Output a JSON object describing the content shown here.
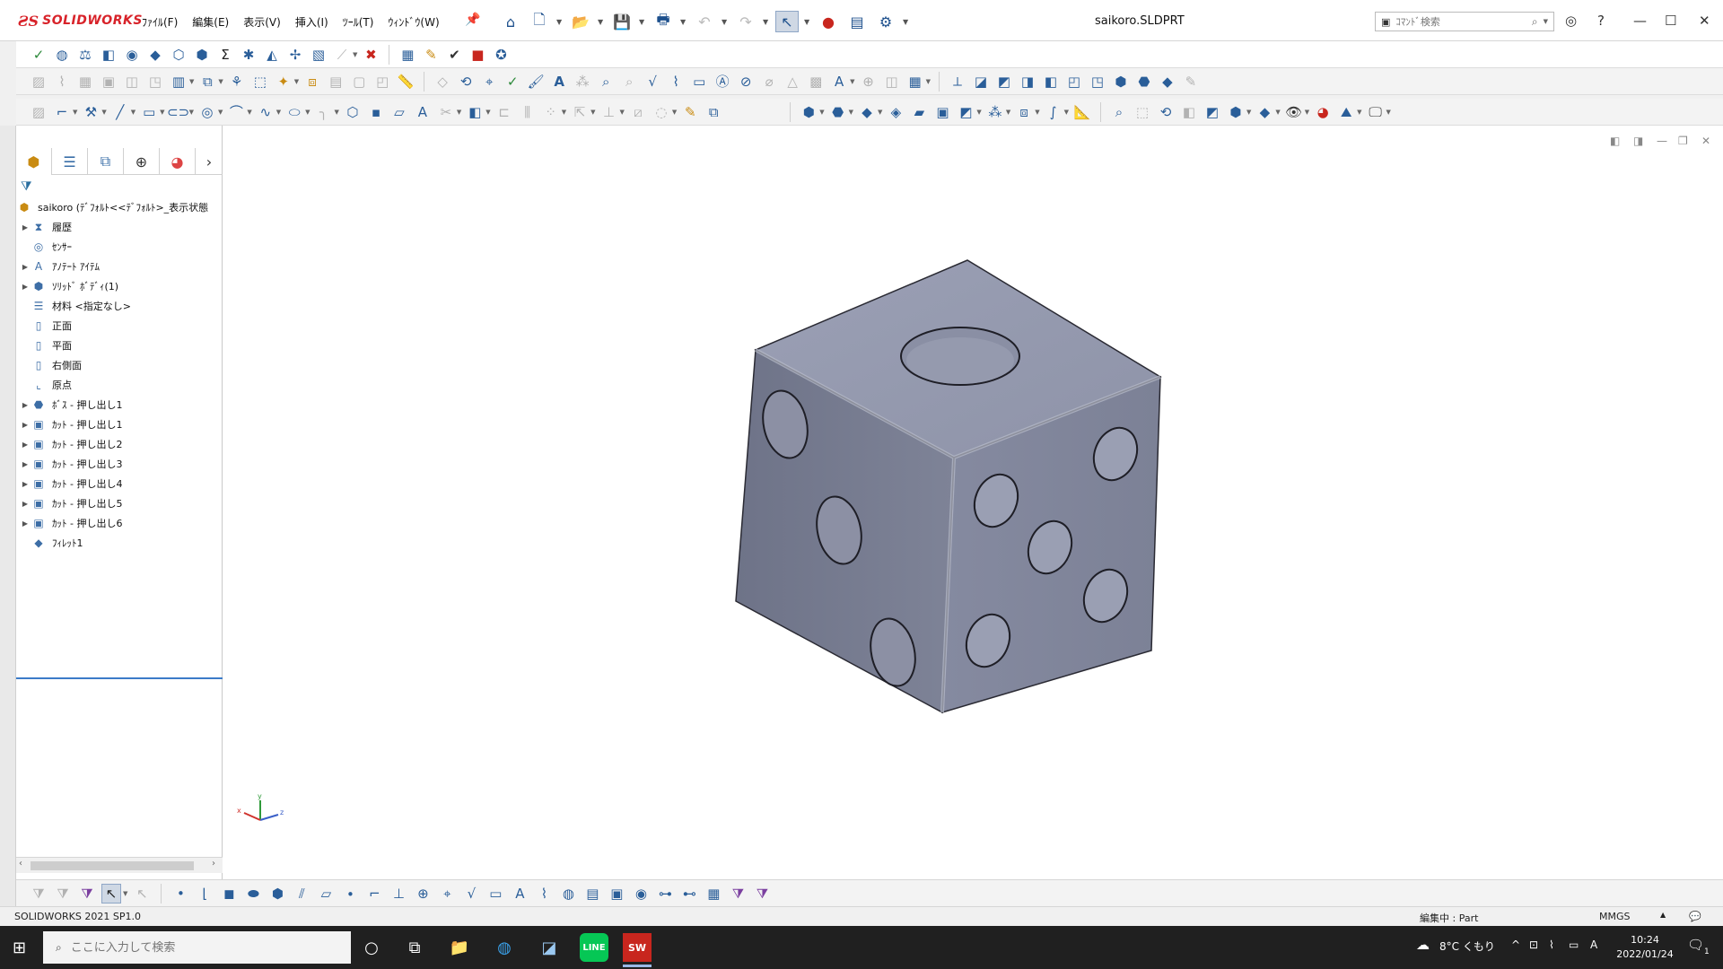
{
  "app": {
    "logo": "SOLIDWORKS",
    "doc_title": "saikoro.SLDPRT"
  },
  "menu": [
    "ﾌｧｲﾙ(F)",
    "編集(E)",
    "表示(V)",
    "挿入(I)",
    "ﾂｰﾙ(T)",
    "ｳｨﾝﾄﾞｳ(W)"
  ],
  "command_search": {
    "placeholder": "ｺﾏﾝﾄﾞ検索"
  },
  "tree": {
    "root": "saikoro  (ﾃﾞﾌｫﾙﾄ<<ﾃﾞﾌｫﾙﾄ>_表示状態",
    "items": [
      {
        "label": "履歴",
        "expandable": true,
        "icon": "history-icon"
      },
      {
        "label": "ｾﾝｻｰ",
        "expandable": false,
        "icon": "sensor-icon"
      },
      {
        "label": "ｱﾉﾃｰﾄ ｱｲﾃﾑ",
        "expandable": true,
        "icon": "annotation-icon"
      },
      {
        "label": "ｿﾘｯﾄﾞ ﾎﾞﾃﾞｨ(1)",
        "expandable": true,
        "icon": "solid-body-icon"
      },
      {
        "label": "材料 <指定なし>",
        "expandable": false,
        "icon": "material-icon"
      },
      {
        "label": "正面",
        "expandable": false,
        "icon": "plane-icon"
      },
      {
        "label": "平面",
        "expandable": false,
        "icon": "plane-icon"
      },
      {
        "label": "右側面",
        "expandable": false,
        "icon": "plane-icon"
      },
      {
        "label": "原点",
        "expandable": false,
        "icon": "origin-icon"
      },
      {
        "label": "ﾎﾞｽ - 押し出し1",
        "expandable": true,
        "icon": "boss-extrude-icon"
      },
      {
        "label": "ｶｯﾄ - 押し出し1",
        "expandable": true,
        "icon": "cut-extrude-icon"
      },
      {
        "label": "ｶｯﾄ - 押し出し2",
        "expandable": true,
        "icon": "cut-extrude-icon"
      },
      {
        "label": "ｶｯﾄ - 押し出し3",
        "expandable": true,
        "icon": "cut-extrude-icon"
      },
      {
        "label": "ｶｯﾄ - 押し出し4",
        "expandable": true,
        "icon": "cut-extrude-icon"
      },
      {
        "label": "ｶｯﾄ - 押し出し5",
        "expandable": true,
        "icon": "cut-extrude-icon"
      },
      {
        "label": "ｶｯﾄ - 押し出し6",
        "expandable": true,
        "icon": "cut-extrude-icon"
      },
      {
        "label": "ﾌｨﾚｯﾄ1",
        "expandable": false,
        "icon": "fillet-icon"
      }
    ]
  },
  "triad": {
    "x": "x",
    "y": "y",
    "z": "z"
  },
  "status": {
    "version": "SOLIDWORKS 2021 SP1.0",
    "editing": "編集中 :  Part",
    "units": "MMGS"
  },
  "taskbar": {
    "search_placeholder": "ここに入力して検索",
    "weather": "8°C くもり",
    "ime": "A",
    "time": "10:24",
    "date": "2022/01/24",
    "notifications": "1"
  }
}
